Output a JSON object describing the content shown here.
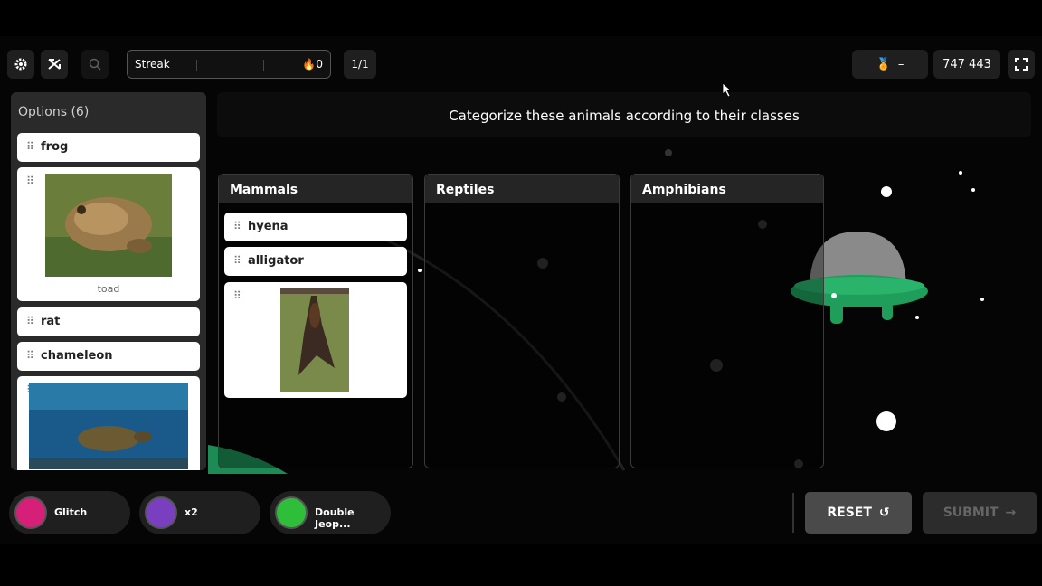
{
  "toolbar": {
    "streak_label": "Streak",
    "streak_count": "0",
    "question_count": "1/1",
    "badge_value": "–",
    "score": "747 443"
  },
  "options": {
    "title": "Options (6)",
    "items": [
      {
        "label": "frog"
      },
      {
        "label": "toad",
        "type": "image"
      },
      {
        "label": "rat"
      },
      {
        "label": "chameleon"
      }
    ]
  },
  "question": "Categorize these animals according to their classes",
  "columns": [
    {
      "title": "Mammals",
      "items": [
        {
          "label": "hyena"
        },
        {
          "label": "alligator"
        }
      ]
    },
    {
      "title": "Reptiles",
      "items": []
    },
    {
      "title": "Amphibians",
      "items": []
    }
  ],
  "powerups": [
    {
      "label": "Glitch",
      "color": "#d61f78"
    },
    {
      "label": "x2",
      "color": "#7a3fc0"
    },
    {
      "label": "Double Jeop...",
      "color": "#2fbe3a"
    }
  ],
  "actions": {
    "reset": "RESET",
    "submit": "SUBMIT"
  },
  "colors": {
    "ufo_body": "#7a7a7a",
    "ufo_ring": "#1e9e5a",
    "accent_turtle": "#1a5a8a"
  }
}
